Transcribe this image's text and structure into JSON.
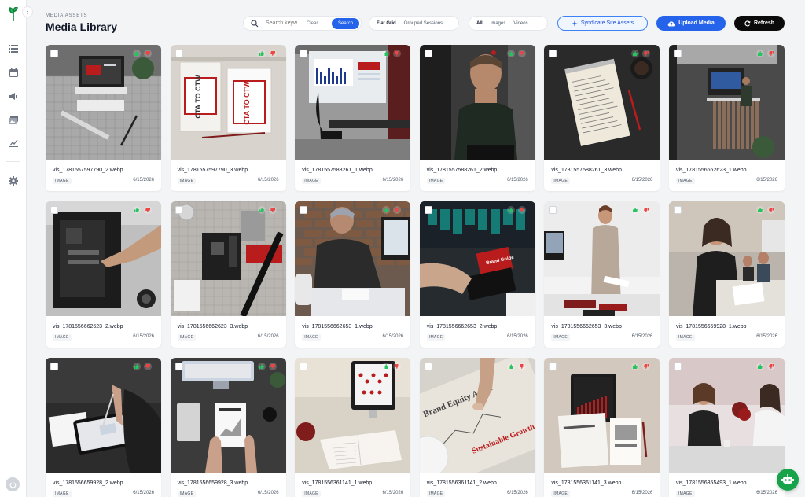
{
  "header": {
    "eyebrow": "MEDIA ASSETS",
    "title": "Media Library"
  },
  "search": {
    "placeholder": "Search keyw",
    "clear_label": "Clear",
    "search_label": "Search"
  },
  "view_mode": {
    "options": [
      "Flat Grid",
      "Grouped Sessions"
    ],
    "selected": "Flat Grid"
  },
  "type_filter": {
    "options": [
      "All",
      "Images",
      "Videos"
    ],
    "selected": "All"
  },
  "actions": {
    "syndicate_label": "Syndicate Site Assets",
    "upload_label": "Upload Media",
    "refresh_label": "Refresh"
  },
  "sidebar": {
    "icons": [
      "list-icon",
      "calendar-icon",
      "megaphone-icon",
      "images-icon",
      "chart-icon",
      "gear-icon"
    ]
  },
  "colors": {
    "accent": "#2563eb",
    "dark_button": "#0b0b0b",
    "chat_fab": "#16a34a"
  },
  "assets": [
    {
      "name": "vis_1781557597790_2.webp",
      "type": "IMAGE",
      "date": "6/15/2026",
      "scene": "laptop-desk"
    },
    {
      "name": "vis_1781557597790_3.webp",
      "type": "IMAGE",
      "date": "6/15/2026",
      "scene": "cta-signs"
    },
    {
      "name": "vis_1781557588261_1.webp",
      "type": "IMAGE",
      "date": "6/15/2026",
      "scene": "office-screen"
    },
    {
      "name": "vis_1781557588261_2.webp",
      "type": "IMAGE",
      "date": "6/15/2026",
      "scene": "man-portrait"
    },
    {
      "name": "vis_1781557588261_3.webp",
      "type": "IMAGE",
      "date": "6/15/2026",
      "scene": "notepad"
    },
    {
      "name": "vis_1781556662623_1.webp",
      "type": "IMAGE",
      "date": "6/15/2026",
      "scene": "server-room"
    },
    {
      "name": "vis_1781556662623_2.webp",
      "type": "IMAGE",
      "date": "6/15/2026",
      "scene": "pc-build"
    },
    {
      "name": "vis_1781556662623_3.webp",
      "type": "IMAGE",
      "date": "6/15/2026",
      "scene": "motherboard"
    },
    {
      "name": "vis_1781556662653_1.webp",
      "type": "IMAGE",
      "date": "6/15/2026",
      "scene": "man-writing"
    },
    {
      "name": "vis_1781556662653_2.webp",
      "type": "IMAGE",
      "date": "6/15/2026",
      "scene": "keyboard-screen"
    },
    {
      "name": "vis_1781556662653_3.webp",
      "type": "IMAGE",
      "date": "6/15/2026",
      "scene": "woman-standing"
    },
    {
      "name": "vis_1781556659928_1.webp",
      "type": "IMAGE",
      "date": "6/15/2026",
      "scene": "meeting"
    },
    {
      "name": "vis_1781556659928_2.webp",
      "type": "IMAGE",
      "date": "6/15/2026",
      "scene": "tablet-hand"
    },
    {
      "name": "vis_1781556659928_3.webp",
      "type": "IMAGE",
      "date": "6/15/2026",
      "scene": "report-desk"
    },
    {
      "name": "vis_1781556361141_1.webp",
      "type": "IMAGE",
      "date": "6/15/2026",
      "scene": "monitor-book"
    },
    {
      "name": "vis_1781556361141_2.webp",
      "type": "IMAGE",
      "date": "6/15/2026",
      "scene": "brand-audit"
    },
    {
      "name": "vis_1781556361141_3.webp",
      "type": "IMAGE",
      "date": "6/15/2026",
      "scene": "tablet-report"
    },
    {
      "name": "vis_1781556355493_1.webp",
      "type": "IMAGE",
      "date": "6/15/2026",
      "scene": "two-women"
    }
  ]
}
